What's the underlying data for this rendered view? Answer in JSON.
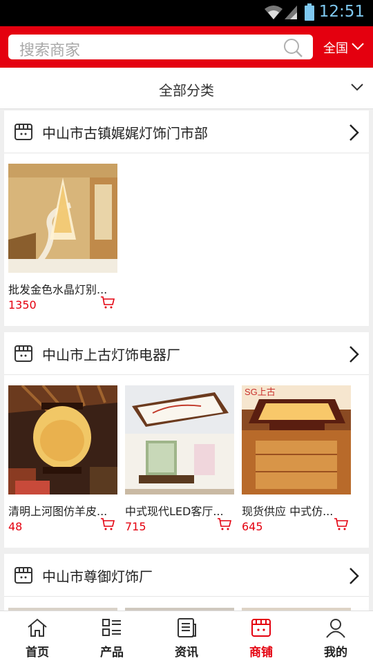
{
  "status_bar": {
    "time": "12:51"
  },
  "header": {
    "search_placeholder": "搜索商家",
    "region_label": "全国"
  },
  "category_bar": {
    "label": "全部分类"
  },
  "shops": [
    {
      "name": "中山市古镇娓娓灯饰门市部",
      "products": [
        {
          "title": "批发金色水晶灯别...",
          "price": "1350"
        }
      ]
    },
    {
      "name": "中山市上古灯饰电器厂",
      "products": [
        {
          "title": "清明上河图仿羊皮...",
          "price": "48"
        },
        {
          "title": "中式现代LED客厅...",
          "price": "715"
        },
        {
          "title": "现货供应 中式仿...",
          "price": "645",
          "brand_mark": "SG上古"
        }
      ]
    },
    {
      "name": "中山市尊御灯饰厂",
      "products": []
    }
  ],
  "tabbar": {
    "items": [
      {
        "label": "首页",
        "icon": "home-icon"
      },
      {
        "label": "产品",
        "icon": "grid-list-icon"
      },
      {
        "label": "资讯",
        "icon": "news-icon"
      },
      {
        "label": "商铺",
        "icon": "store-icon",
        "active": true
      },
      {
        "label": "我的",
        "icon": "user-icon"
      }
    ]
  },
  "colors": {
    "brand_red": "#e4000f",
    "price_red": "#e4000f",
    "status_time": "#7ec8f0"
  }
}
